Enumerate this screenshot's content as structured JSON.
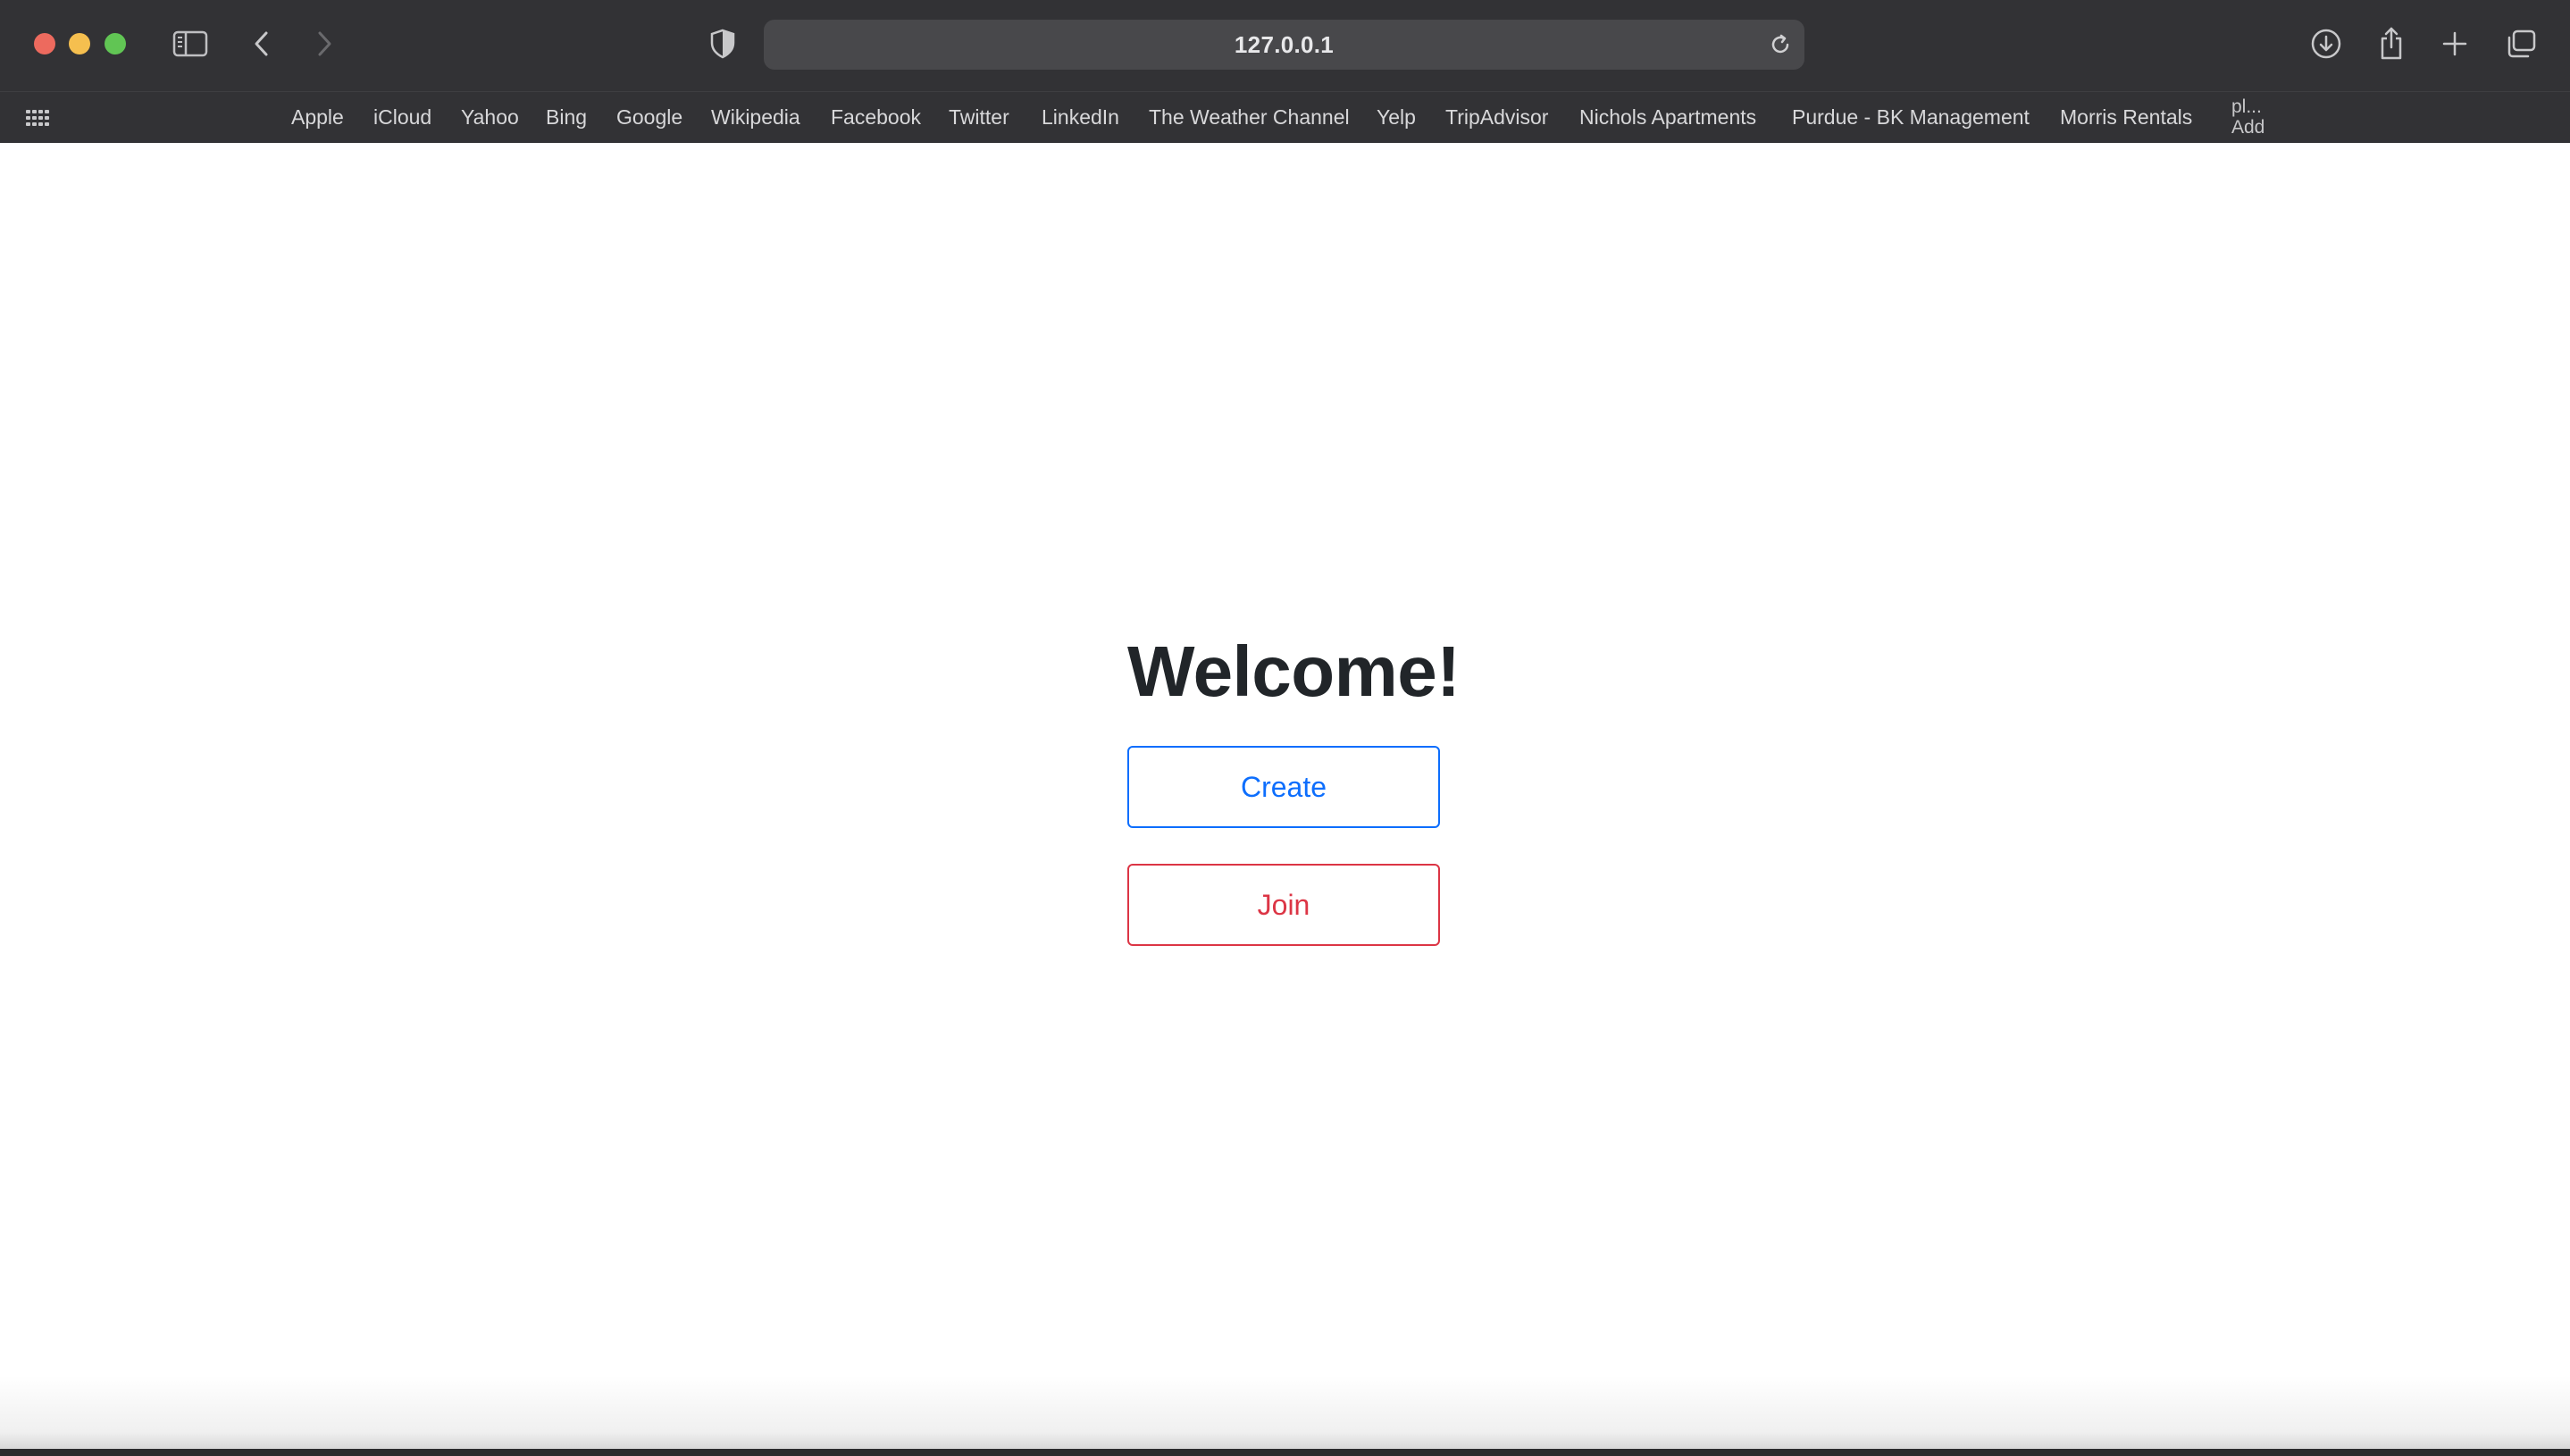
{
  "browser": {
    "address": "127.0.0.1",
    "favorites": [
      "Apple",
      "iCloud",
      "Yahoo",
      "Bing",
      "Google",
      "Wikipedia",
      "Facebook",
      "Twitter",
      "LinkedIn",
      "The Weather Channel",
      "Yelp",
      "TripAdvisor",
      "Nichols Apartments",
      "Purdue - BK Management",
      "Morris Rentals"
    ],
    "favorites_overflow": [
      "pl...",
      "Add"
    ],
    "colors": {
      "chrome": "#323235",
      "address_bg": "#48484b",
      "close": "#ed6a5e",
      "minimize": "#f5bf4f",
      "maximize": "#61c554"
    },
    "icons": [
      "sidebar-icon",
      "back-icon",
      "forward-icon",
      "privacy-shield-icon",
      "reload-icon",
      "download-icon",
      "share-icon",
      "new-tab-icon",
      "tab-overview-icon",
      "favorites-grid-icon"
    ]
  },
  "page": {
    "heading": "Welcome!",
    "create_label": "Create",
    "join_label": "Join",
    "colors": {
      "create": "#0d6efd",
      "join": "#dc3545",
      "heading": "#212529"
    }
  }
}
